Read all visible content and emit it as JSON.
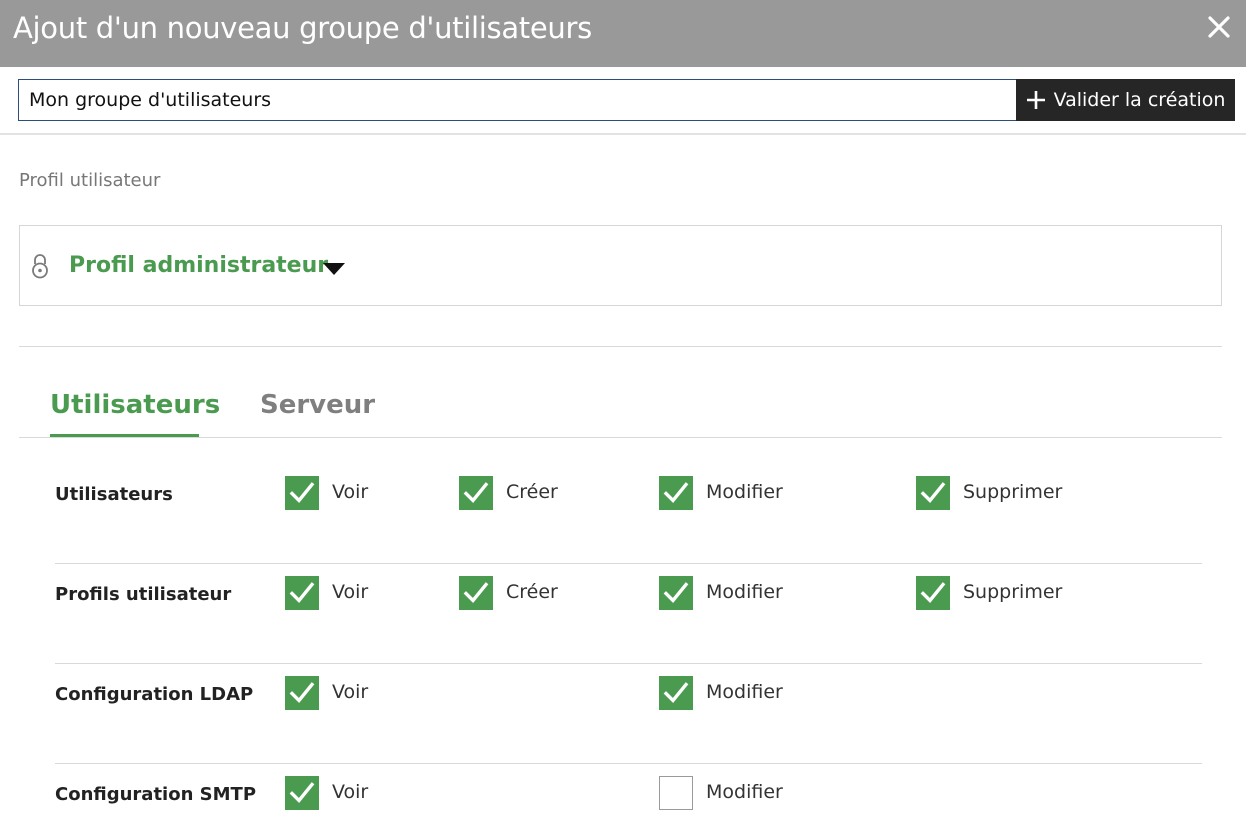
{
  "dialog": {
    "title": "Ajout d'un nouveau groupe d'utilisateurs",
    "close_icon": "close-icon"
  },
  "group_name": {
    "value": "Mon groupe d'utilisateurs"
  },
  "validate_button": {
    "label": "Valider la création",
    "icon": "plus-icon"
  },
  "profile": {
    "label": "Profil utilisateur",
    "selected": "Profil administrateur",
    "icon": "lock-icon"
  },
  "tabs": [
    {
      "label": "Utilisateurs",
      "active": true
    },
    {
      "label": "Serveur",
      "active": false
    }
  ],
  "colors": {
    "accent": "#4a9a4f",
    "header": "#999999",
    "button": "#262626"
  },
  "permissions": [
    {
      "label": "Utilisateurs",
      "items": {
        "voir": {
          "label": "Voir",
          "checked": true
        },
        "creer": {
          "label": "Créer",
          "checked": true
        },
        "modifier": {
          "label": "Modifier",
          "checked": true
        },
        "supprimer": {
          "label": "Supprimer",
          "checked": true
        }
      }
    },
    {
      "label": "Profils utilisateur",
      "items": {
        "voir": {
          "label": "Voir",
          "checked": true
        },
        "creer": {
          "label": "Créer",
          "checked": true
        },
        "modifier": {
          "label": "Modifier",
          "checked": true
        },
        "supprimer": {
          "label": "Supprimer",
          "checked": true
        }
      }
    },
    {
      "label": "Configuration LDAP",
      "items": {
        "voir": {
          "label": "Voir",
          "checked": true
        },
        "modifier": {
          "label": "Modifier",
          "checked": true
        }
      }
    },
    {
      "label": "Configuration SMTP",
      "items": {
        "voir": {
          "label": "Voir",
          "checked": true
        },
        "modifier": {
          "label": "Modifier",
          "checked": false
        }
      }
    }
  ]
}
